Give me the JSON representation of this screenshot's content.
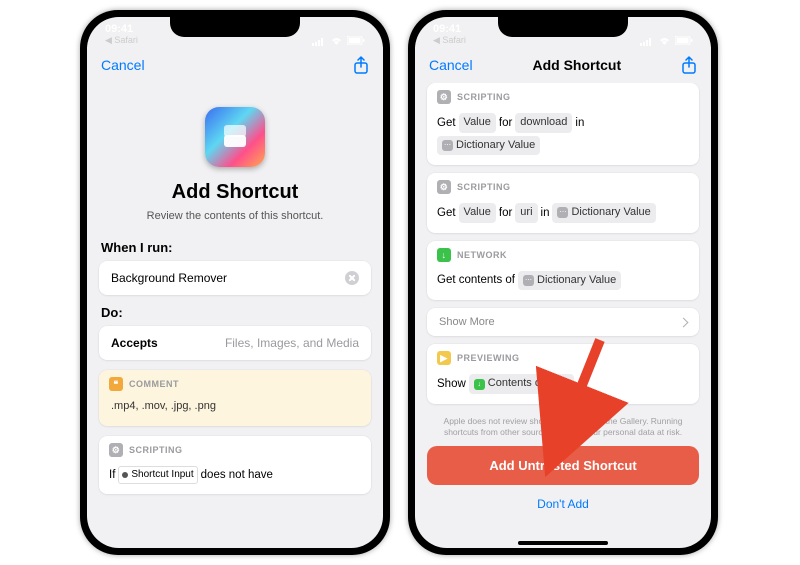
{
  "status": {
    "time": "09:41",
    "back_app": "Safari"
  },
  "nav": {
    "cancel": "Cancel",
    "title": "Add Shortcut"
  },
  "left": {
    "title": "Add Shortcut",
    "subtitle": "Review the contents of this shortcut.",
    "when_label": "When I run:",
    "shortcut_name": "Background Remover",
    "do_label": "Do:",
    "accepts_label": "Accepts",
    "accepts_value": "Files, Images, and Media",
    "comment_head": "COMMENT",
    "comment_body": ".mp4, .mov, .jpg, .png",
    "scripting_head": "SCRIPTING",
    "if_word": "If",
    "input_token": "Shortcut Input",
    "does_not": "does not have"
  },
  "right": {
    "scripting_head": "SCRIPTING",
    "get_word": "Get",
    "value_word": "Value",
    "for_word": "for",
    "download_word": "download",
    "uri_word": "uri",
    "in_word": "in",
    "dict_value": "Dictionary Value",
    "network_head": "NETWORK",
    "contents_phrase": "Get contents of",
    "show_more": "Show More",
    "previewing_head": "PREVIEWING",
    "show_word": "Show",
    "contents_url": "Contents of URL",
    "disclaimer": "Apple does not review shortcuts outside of the Gallery. Running shortcuts from other sources can put your personal data at risk.",
    "primary": "Add Untrusted Shortcut",
    "secondary": "Don't Add"
  }
}
